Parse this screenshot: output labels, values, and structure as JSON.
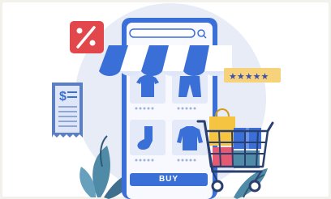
{
  "illustration": {
    "phone_screen": {
      "buy_button_label": "BUY",
      "product_icons": [
        "tshirt-icon",
        "shorts-icon",
        "sock-icon",
        "sweater-icon"
      ]
    },
    "discount_badge_icon": "percent-icon",
    "rating_badge_icon": "five-stars-icon",
    "receipt_icon": "dollar-receipt-icon",
    "cart_icon": "shopping-cart-icon",
    "colors": {
      "accent_blue": "#3a6fd8",
      "light_blue": "#dfe6f7",
      "discount_red": "#e2474b",
      "star_gold": "#f1bd3f",
      "plant_teal": "#4f8aa7",
      "cart_pink": "#e45a72"
    }
  }
}
